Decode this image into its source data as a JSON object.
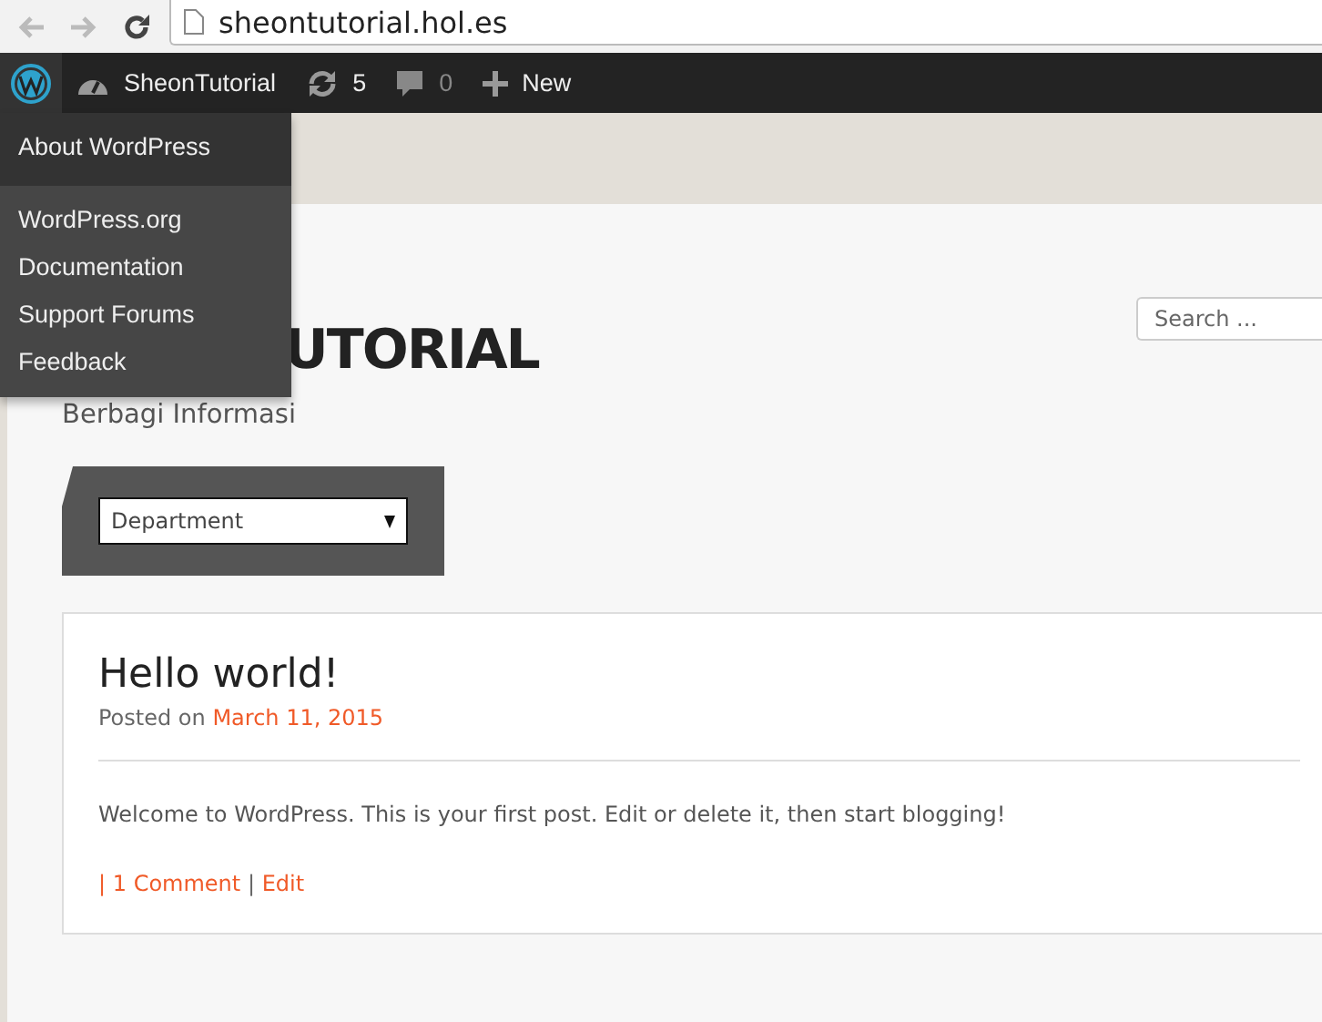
{
  "browser": {
    "url": "sheontutorial.hol.es"
  },
  "admin_bar": {
    "logo_menu": {
      "expanded": true,
      "groups": [
        {
          "items": [
            {
              "label": "About WordPress"
            }
          ]
        },
        {
          "items": [
            {
              "label": "WordPress.org"
            },
            {
              "label": "Documentation"
            },
            {
              "label": "Support Forums"
            },
            {
              "label": "Feedback"
            }
          ]
        }
      ]
    },
    "site_name": "SheonTutorial",
    "updates": "5",
    "comments": "0",
    "new_label": "New"
  },
  "site": {
    "title": "UTORIAL",
    "tagline": "Berbagi Informasi"
  },
  "search": {
    "placeholder": "Search ..."
  },
  "category_select": {
    "value": "Department"
  },
  "post": {
    "title": "Hello world!",
    "posted_prefix": "Posted on",
    "date": "March 11, 2015",
    "body": "Welcome to WordPress. This is your first post. Edit or delete it, then start blogging!",
    "separator_1": "|",
    "comments_link": "1 Comment",
    "separator_2": "|",
    "edit_link": "Edit"
  }
}
